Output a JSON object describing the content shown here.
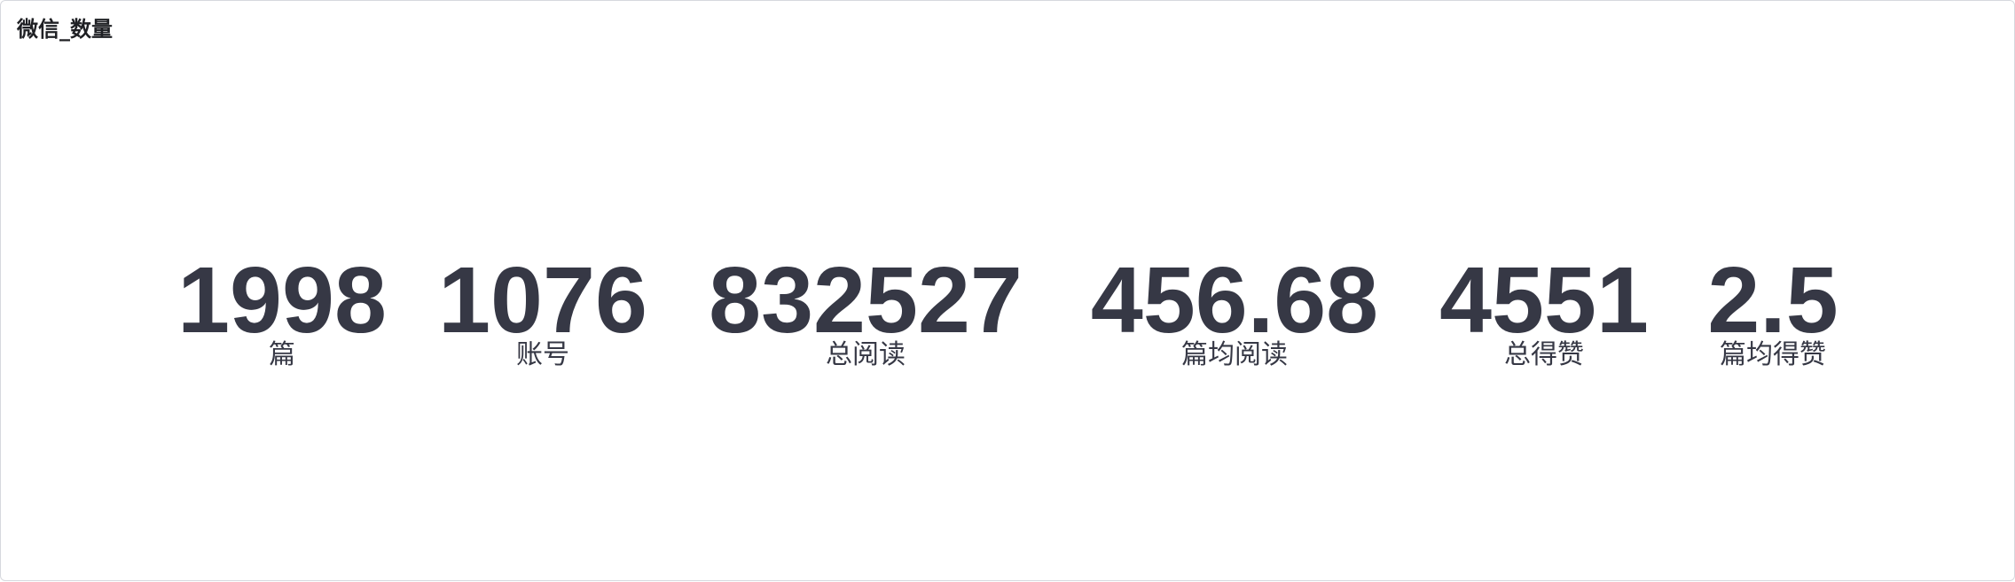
{
  "panel": {
    "title": "微信_数量"
  },
  "metrics": [
    {
      "value": "1998",
      "label": "篇"
    },
    {
      "value": "1076",
      "label": "账号"
    },
    {
      "value": "832527",
      "label": "总阅读"
    },
    {
      "value": "456.68",
      "label": "篇均阅读"
    },
    {
      "value": "4551",
      "label": "总得赞"
    },
    {
      "value": "2.5",
      "label": "篇均得赞"
    }
  ],
  "colors": {
    "value_text": "#363845",
    "title_text": "#1f2024",
    "border": "#d6d8de",
    "background": "#ffffff"
  }
}
